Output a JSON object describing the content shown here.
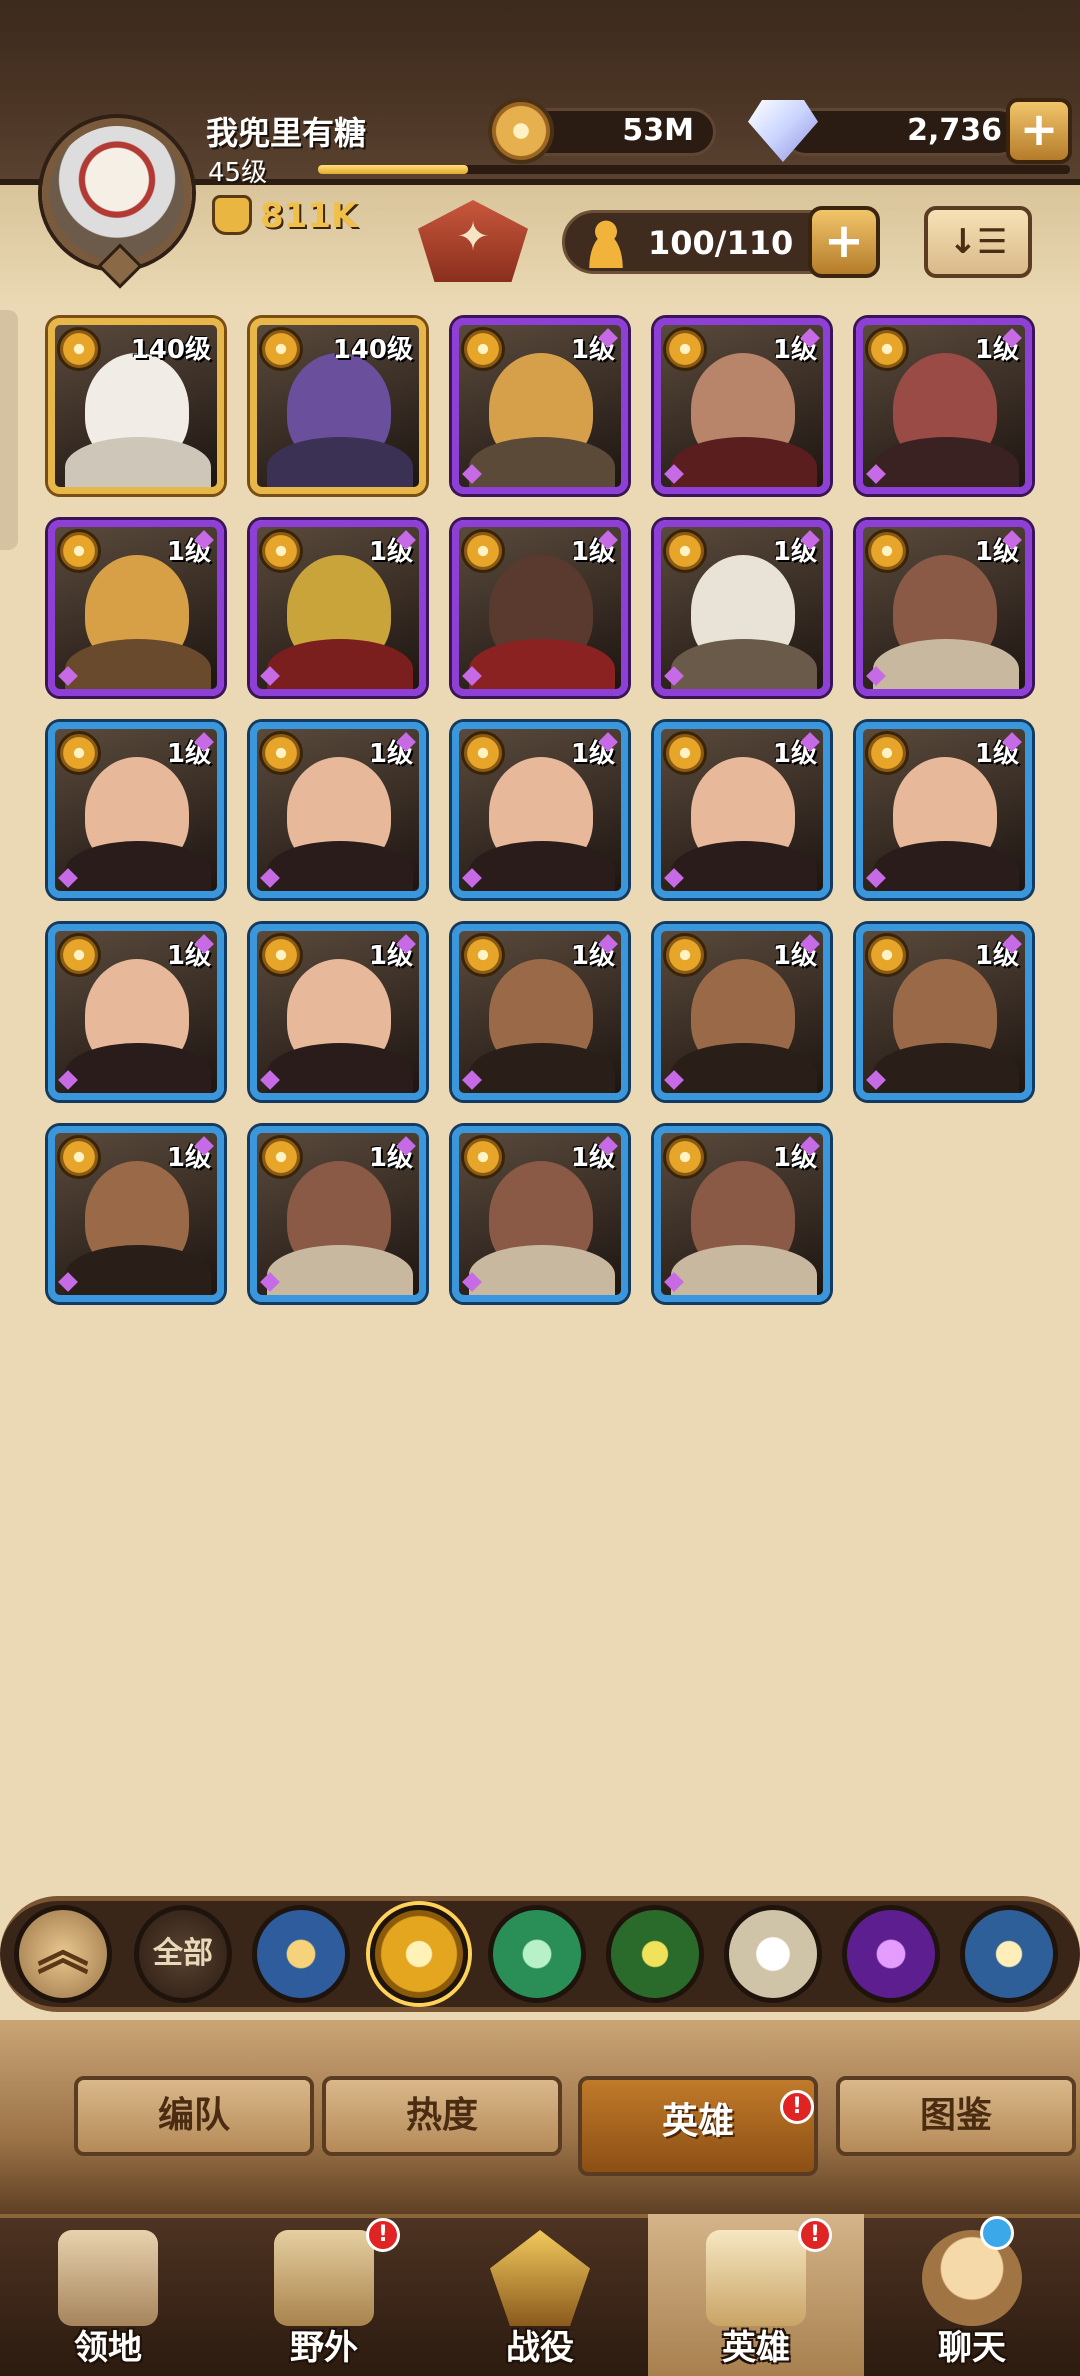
{
  "player": {
    "name": "我兜里有糖",
    "level": "45级",
    "xp_fraction": 0.2,
    "power": "811K"
  },
  "resources": {
    "gold": "53M",
    "gems": "2,736",
    "plus": "+"
  },
  "roster": {
    "capacity": "100/110",
    "plus": "+",
    "sort_glyph": "↓☰"
  },
  "heroes": [
    {
      "level": "140级",
      "rarity": "gold",
      "face": "#f1ede6",
      "body": "#cfc6ba"
    },
    {
      "level": "140级",
      "rarity": "gold",
      "face": "#6a4f9c",
      "body": "#3a3154"
    },
    {
      "level": "1级",
      "rarity": "purple",
      "face": "#d6a04a",
      "body": "#5b4a38"
    },
    {
      "level": "1级",
      "rarity": "purple",
      "face": "#b9856a",
      "body": "#5a1e1e"
    },
    {
      "level": "1级",
      "rarity": "purple",
      "face": "#9a4b45",
      "body": "#3b2222"
    },
    {
      "level": "1级",
      "rarity": "purple",
      "face": "#d8a046",
      "body": "#6a4a2c"
    },
    {
      "level": "1级",
      "rarity": "purple",
      "face": "#c9a43a",
      "body": "#7a1e1e"
    },
    {
      "level": "1级",
      "rarity": "purple",
      "face": "#5a3a2e",
      "body": "#8a2222"
    },
    {
      "level": "1级",
      "rarity": "purple",
      "face": "#e9e2d6",
      "body": "#6a5a4a"
    },
    {
      "level": "1级",
      "rarity": "purple",
      "face": "#8a5a46",
      "body": "#c9b8a0"
    },
    {
      "level": "1级",
      "rarity": "blue",
      "face": "#e7b89a",
      "body": "#2a1c1a"
    },
    {
      "level": "1级",
      "rarity": "blue",
      "face": "#e7b89a",
      "body": "#2a1c1a"
    },
    {
      "level": "1级",
      "rarity": "blue",
      "face": "#e7b89a",
      "body": "#2a1c1a"
    },
    {
      "level": "1级",
      "rarity": "blue",
      "face": "#e7b89a",
      "body": "#2a1c1a"
    },
    {
      "level": "1级",
      "rarity": "blue",
      "face": "#e7b89a",
      "body": "#2a1c1a"
    },
    {
      "level": "1级",
      "rarity": "blue",
      "face": "#e7b89a",
      "body": "#2a1c1a"
    },
    {
      "level": "1级",
      "rarity": "blue",
      "face": "#e7b89a",
      "body": "#2a1c1a"
    },
    {
      "level": "1级",
      "rarity": "blue",
      "face": "#9a6a48",
      "body": "#2a1f18"
    },
    {
      "level": "1级",
      "rarity": "blue",
      "face": "#9a6a48",
      "body": "#2a1f18"
    },
    {
      "level": "1级",
      "rarity": "blue",
      "face": "#9a6a48",
      "body": "#2a1f18"
    },
    {
      "level": "1级",
      "rarity": "blue",
      "face": "#9a6a48",
      "body": "#2a1f18"
    },
    {
      "level": "1级",
      "rarity": "blue",
      "face": "#8a5a46",
      "body": "#c9b8a0"
    },
    {
      "level": "1级",
      "rarity": "blue",
      "face": "#8a5a46",
      "body": "#c9b8a0"
    },
    {
      "level": "1级",
      "rarity": "blue",
      "face": "#8a5a46",
      "body": "#c9b8a0"
    }
  ],
  "filter": {
    "collapse_glyph": "︽",
    "all_label": "全部",
    "factions": [
      "lightbearer-icon",
      "mauler-icon",
      "wilder-icon",
      "graveborn-icon",
      "celestial-icon",
      "hypogean-icon",
      "dimensional-icon"
    ],
    "selected": "mauler-icon"
  },
  "sub_tabs": [
    "编队",
    "热度",
    "英雄",
    "图鉴"
  ],
  "sub_tab_active": "英雄",
  "nav": {
    "items": [
      "领地",
      "野外",
      "战役",
      "英雄",
      "聊天"
    ],
    "active": "英雄",
    "badge": "!"
  },
  "colors": {
    "gold_frame": "#e8b74a",
    "purple_frame": "#8e3fd6",
    "blue_frame": "#3b97dc"
  }
}
